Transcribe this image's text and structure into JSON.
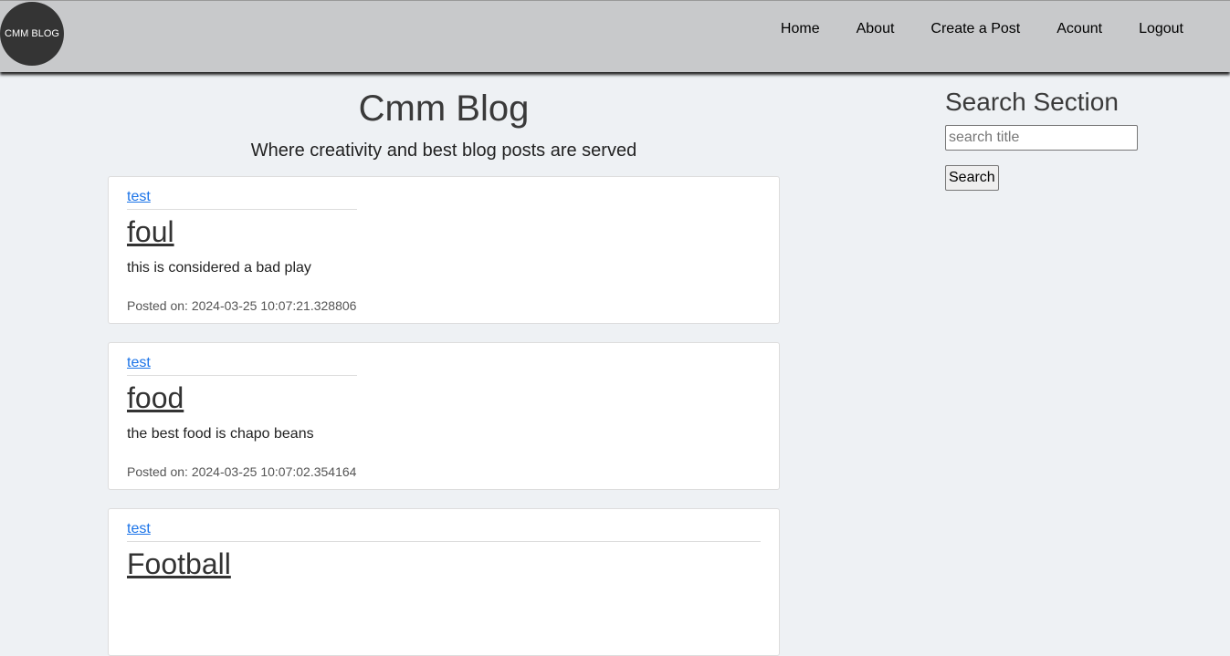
{
  "header": {
    "logo_text": "CMM BLOG",
    "nav": [
      {
        "label": "Home"
      },
      {
        "label": "About"
      },
      {
        "label": "Create a Post"
      },
      {
        "label": "Acount"
      },
      {
        "label": "Logout"
      }
    ]
  },
  "main": {
    "title": "Cmm Blog",
    "subtitle": "Where creativity and best blog posts are served",
    "posts": [
      {
        "author": "test",
        "title": "foul",
        "body": "this is considered a bad play",
        "posted_on": "Posted on: 2024-03-25 10:07:21.328806"
      },
      {
        "author": "test",
        "title": "food",
        "body": "the best food is chapo beans",
        "posted_on": "Posted on: 2024-03-25 10:07:02.354164"
      },
      {
        "author": "test",
        "title": "Football"
      }
    ]
  },
  "sidebar": {
    "title": "Search Section",
    "search_placeholder": "search title",
    "search_button": "Search"
  },
  "colors": {
    "navbar_bg": "#c8c9cb",
    "page_bg": "#eef1f4",
    "logo_bg": "#343434",
    "link": "#1a73e8"
  }
}
